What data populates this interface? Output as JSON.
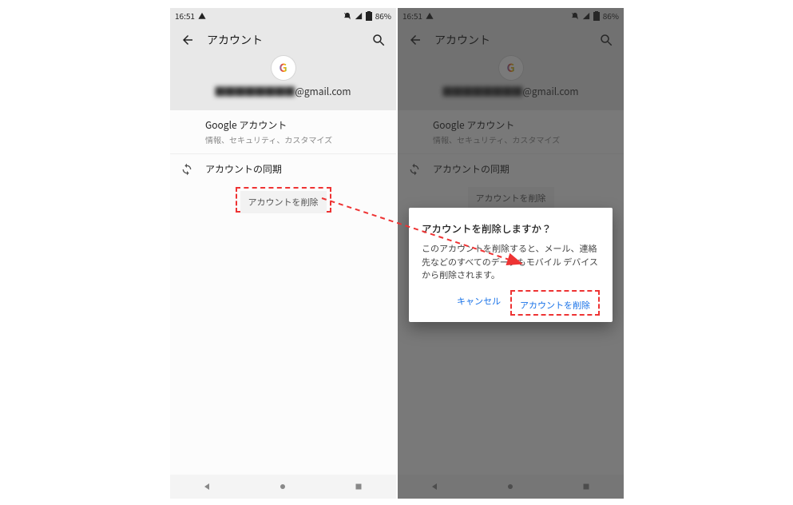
{
  "status": {
    "time": "16:51",
    "battery_text": "86%"
  },
  "appbar": {
    "title": "アカウント"
  },
  "account": {
    "email_masked": "████████",
    "email_domain": "@gmail.com",
    "google_glyph": "G"
  },
  "rows": {
    "google_account": {
      "title": "Google アカウント",
      "subtitle": "情報、セキュリティ、カスタマイズ"
    },
    "sync": {
      "title": "アカウントの同期"
    }
  },
  "remove_button": "アカウントを削除",
  "dialog": {
    "title": "アカウントを削除しますか？",
    "body": "このアカウントを削除すると、メール、連絡先などのすべてのデータもモバイル デバイスから削除されます。",
    "cancel": "キャンセル",
    "confirm": "アカウントを削除"
  }
}
